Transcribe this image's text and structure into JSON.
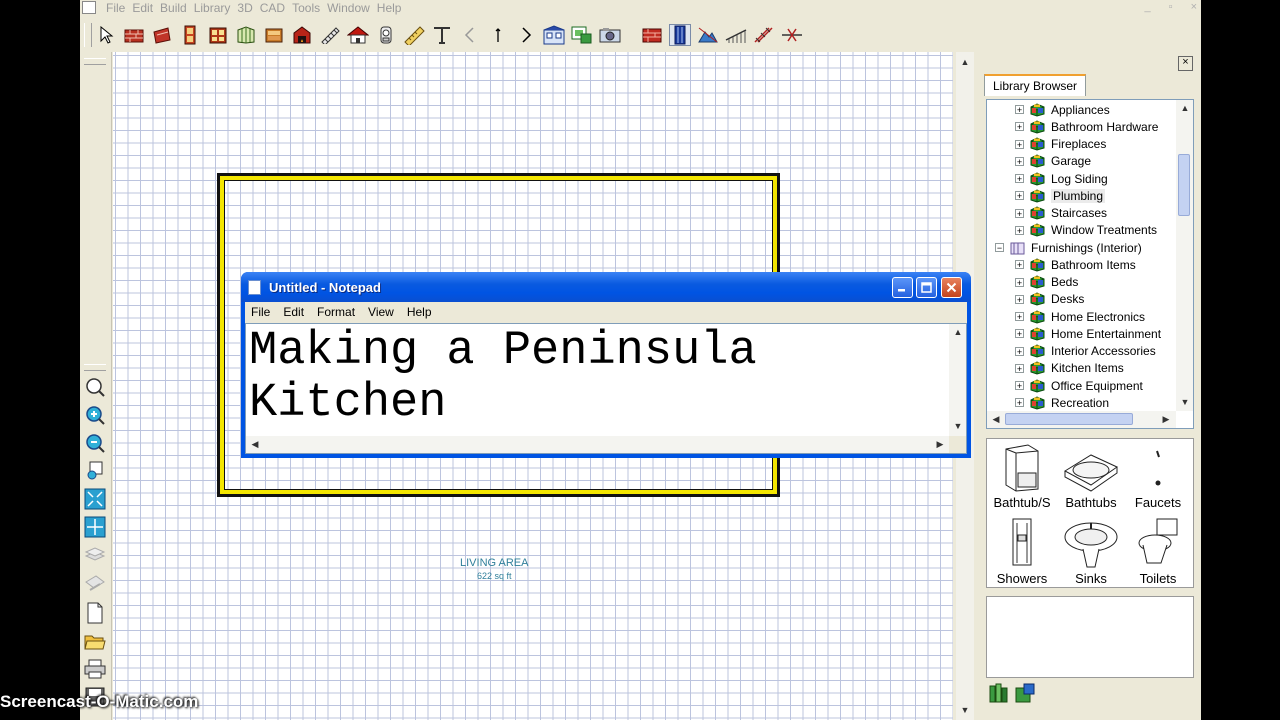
{
  "app": {
    "menus": [
      "File",
      "Edit",
      "Build",
      "Library",
      "3D",
      "CAD",
      "Tools",
      "Window",
      "Help"
    ],
    "window_controls": [
      "_",
      "▫",
      "×"
    ]
  },
  "toolbar": {
    "icons": [
      "select-arrow-icon",
      "wall-icon",
      "cabinet-icon",
      "door-icon",
      "window-icon",
      "shelf-icon",
      "furniture-icon",
      "fireplace-icon",
      "stairs-icon",
      "roof-icon",
      "fixture-icon",
      "dimension-icon",
      "text-icon",
      "previous-icon",
      "up-icon",
      "next-icon",
      "elevation-icon",
      "library-icon",
      "camera-icon",
      "brick-icon",
      "column-icon",
      "terrain-icon",
      "railing-icon",
      "polyline-icon",
      "break-icon"
    ]
  },
  "left_tools": {
    "icons": [
      "zoom-icon",
      "zoom-in-icon",
      "zoom-out-icon",
      "undo-zoom-icon",
      "fill-window-icon",
      "center-icon",
      "layer-icon",
      "move-icon",
      "new-icon",
      "open-icon",
      "print-icon",
      "save-icon"
    ]
  },
  "canvas": {
    "room_label": "LIVING AREA",
    "room_area": "622 sq ft",
    "wall_color": "#f4e600",
    "grid_color": "#bcc4de"
  },
  "library": {
    "tab_label": "Library Browser",
    "close_glyph": "×",
    "tree": [
      {
        "label": "Appliances",
        "expander": "+",
        "level": 1
      },
      {
        "label": "Bathroom Hardware",
        "expander": "+",
        "level": 1
      },
      {
        "label": "Fireplaces",
        "expander": "+",
        "level": 1
      },
      {
        "label": "Garage",
        "expander": "+",
        "level": 1
      },
      {
        "label": "Log Siding",
        "expander": "+",
        "level": 1
      },
      {
        "label": "Plumbing",
        "expander": "+",
        "level": 1,
        "highlighted": true
      },
      {
        "label": "Staircases",
        "expander": "+",
        "level": 1
      },
      {
        "label": "Window Treatments",
        "expander": "+",
        "level": 1
      },
      {
        "label": "Furnishings (Interior)",
        "expander": "−",
        "level": 0
      },
      {
        "label": "Bathroom Items",
        "expander": "+",
        "level": 1
      },
      {
        "label": "Beds",
        "expander": "+",
        "level": 1
      },
      {
        "label": "Desks",
        "expander": "+",
        "level": 1
      },
      {
        "label": "Home Electronics",
        "expander": "+",
        "level": 1
      },
      {
        "label": "Home Entertainment",
        "expander": "+",
        "level": 1
      },
      {
        "label": "Interior Accessories",
        "expander": "+",
        "level": 1
      },
      {
        "label": "Kitchen Items",
        "expander": "+",
        "level": 1
      },
      {
        "label": "Office Equipment",
        "expander": "+",
        "level": 1
      },
      {
        "label": "Recreation",
        "expander": "+",
        "level": 1
      }
    ],
    "preview_items": [
      "Bathtub/S",
      "Bathtubs",
      "Faucets",
      "Showers",
      "Sinks",
      "Toilets"
    ]
  },
  "notepad": {
    "title": "Untitled - Notepad",
    "menus": [
      "File",
      "Edit",
      "Format",
      "View",
      "Help"
    ],
    "text": "Making a Peninsula\nKitchen"
  },
  "watermark": "Screencast-O-Matic.com"
}
